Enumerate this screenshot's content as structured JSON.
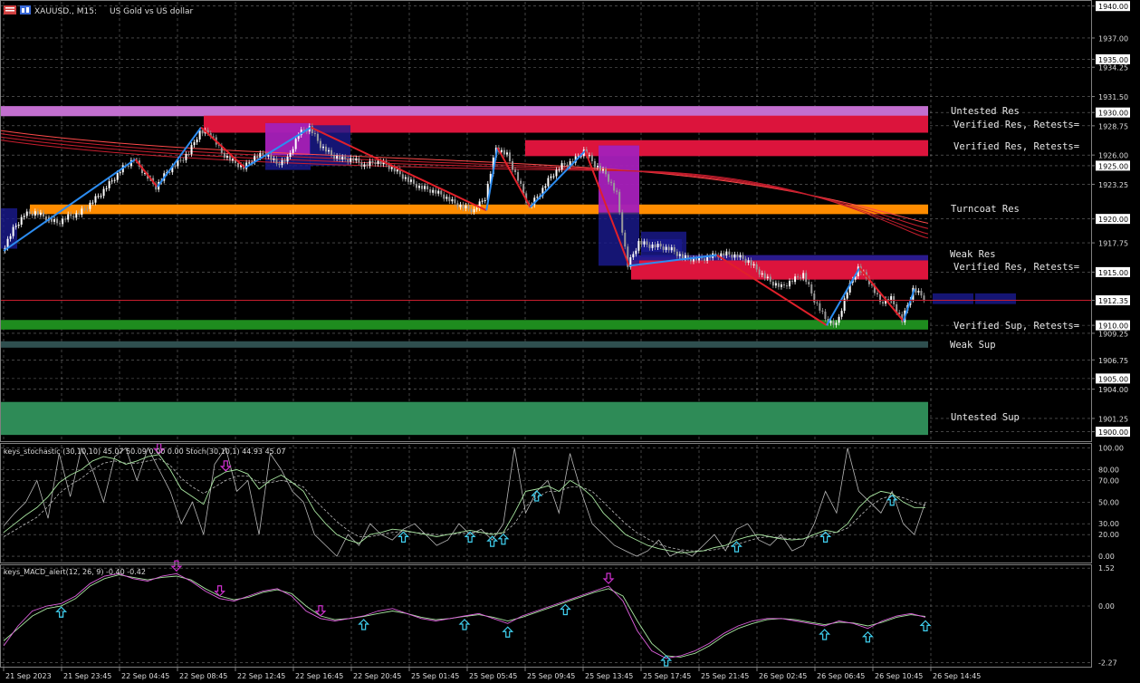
{
  "header": {
    "symbol": "XAUUSD., M15:",
    "description": "US Gold vs US dollar"
  },
  "colors": {
    "background": "#000000",
    "frame": "#7f7f7f",
    "candle_bull": "#ffffff",
    "candle_bear": "#9a9a9a",
    "zigzag_up": "#2c8cf0",
    "zigzag_down": "#e0202a",
    "ma": "#c81e2e",
    "untested_res": "#c26fcf",
    "verified_res": "#dc143c",
    "turncoat_res": "#ff8c00",
    "weak_res": "#2a1a8c",
    "verified_sup": "#1e8c1e",
    "weak_sup": "#2f4f4f",
    "untested_sup": "#2e8b57",
    "stoch_main": "#a8e6a0",
    "stoch_signal": "#b8b8b8",
    "macd_line": "#e060e0",
    "macd_signal": "#a8e6a0",
    "arrow_up": "#40d0f0",
    "arrow_down": "#d030d0",
    "price_box": "#ffffff"
  },
  "main_axis": {
    "ymin": 1899.2,
    "ymax": 1940.4,
    "labels": [
      "1940.00",
      "1937.00",
      "1935.00",
      "1934.25",
      "1931.50",
      "1930.00",
      "1928.75",
      "1926.00",
      "1925.00",
      "1923.25",
      "1920.00",
      "1917.75",
      "1915.00",
      "1912.35",
      "1910.00",
      "1909.25",
      "1906.75",
      "1905.00",
      "1904.00",
      "1901.25",
      "1900.00"
    ],
    "boxed": [
      "1940.00",
      "1935.00",
      "1930.00",
      "1925.00",
      "1920.00",
      "1915.00",
      "1912.35",
      "1910.00",
      "1905.00",
      "1900.00"
    ],
    "current_price": 1912.35
  },
  "zones": [
    {
      "label": "Untested Res",
      "color_key": "untested_res",
      "from": 1929.65,
      "to": 1930.6
    },
    {
      "label": "Verified Res, Retests=",
      "color_key": "verified_res",
      "from": 1928.1,
      "to": 1929.7
    },
    {
      "label": "Verified Res, Retests=",
      "color_key": "verified_res",
      "from": 1925.9,
      "to": 1927.4
    },
    {
      "label": "Turncoat Res",
      "color_key": "turncoat_res",
      "from": 1920.45,
      "to": 1921.35
    },
    {
      "label": "Weak Res",
      "color_key": "weak_res",
      "from": 1916.1,
      "to": 1916.6
    },
    {
      "label": "Verified Res, Retests=",
      "color_key": "verified_res",
      "from": 1914.3,
      "to": 1916.1
    },
    {
      "label": "Verified Sup, Retests=",
      "color_key": "verified_sup",
      "from": 1909.6,
      "to": 1910.5
    },
    {
      "label": "Weak Sup",
      "color_key": "weak_sup",
      "from": 1907.9,
      "to": 1908.5
    },
    {
      "label": "Untested Sup",
      "color_key": "untested_sup",
      "from": 1899.7,
      "to": 1902.8
    }
  ],
  "price_path": [
    1917.0,
    1919.0,
    1920.4,
    1920.6,
    1920.1,
    1919.6,
    1920.2,
    1920.5,
    1921.4,
    1922.4,
    1923.6,
    1924.8,
    1925.6,
    1924.2,
    1923.0,
    1924.4,
    1925.3,
    1926.2,
    1928.2,
    1928.0,
    1926.2,
    1925.4,
    1924.8,
    1925.8,
    1926.1,
    1925.2,
    1925.6,
    1928.0,
    1928.6,
    1926.9,
    1926.0,
    1925.6,
    1925.6,
    1925.0,
    1925.4,
    1925.1,
    1924.4,
    1923.6,
    1923.0,
    1922.7,
    1922.3,
    1921.6,
    1921.1,
    1920.8,
    1922.0,
    1926.7,
    1926.0,
    1923.7,
    1921.1,
    1922.4,
    1924.0,
    1925.0,
    1925.4,
    1926.4,
    1925.1,
    1924.2,
    1922.3,
    1915.6,
    1917.8,
    1917.5,
    1917.4,
    1917.1,
    1916.4,
    1916.2,
    1916.3,
    1916.6,
    1916.7,
    1916.5,
    1916.0,
    1915.0,
    1914.1,
    1913.6,
    1914.2,
    1914.8,
    1912.4,
    1910.6,
    1910.0,
    1913.2,
    1915.4,
    1914.1,
    1912.2,
    1912.5,
    1910.4,
    1913.4,
    1912.6
  ],
  "zigzag": [
    [
      0,
      1917.0
    ],
    [
      12,
      1925.6
    ],
    [
      14,
      1923.0
    ],
    [
      18,
      1928.6
    ],
    [
      22,
      1924.8
    ],
    [
      28,
      1928.6
    ],
    [
      44,
      1920.8
    ],
    [
      45,
      1926.7
    ],
    [
      48,
      1921.1
    ],
    [
      53,
      1926.4
    ],
    [
      57,
      1915.6
    ],
    [
      65,
      1916.6
    ],
    [
      75,
      1910.0
    ],
    [
      78,
      1915.4
    ],
    [
      82,
      1910.4
    ],
    [
      83,
      1913.4
    ]
  ],
  "stochastic": {
    "title": "keys_stochastic (30,10,10) 45.07 50.09 0.00 0.00 Stoch(30,10,1) 44.93 45.07",
    "ymin": -5,
    "ymax": 103,
    "labels": [
      "100.00",
      "80.00",
      "70.00",
      "50.00",
      "30.00",
      "20.00",
      "0.00"
    ],
    "main": [
      22,
      30,
      38,
      45,
      55,
      68,
      75,
      80,
      88,
      92,
      90,
      85,
      88,
      92,
      94,
      80,
      62,
      55,
      48,
      72,
      78,
      80,
      76,
      62,
      70,
      75,
      68,
      60,
      42,
      30,
      20,
      15,
      12,
      20,
      22,
      25,
      24,
      22,
      20,
      18,
      20,
      22,
      24,
      22,
      20,
      22,
      40,
      60,
      62,
      65,
      60,
      70,
      64,
      55,
      40,
      30,
      20,
      15,
      10,
      7,
      5,
      3,
      4,
      5,
      8,
      10,
      15,
      18,
      20,
      18,
      16,
      15,
      16,
      20,
      24,
      22,
      30,
      45,
      55,
      60,
      58,
      50,
      45,
      45
    ],
    "signal": [
      18,
      24,
      30,
      36,
      46,
      58,
      66,
      72,
      80,
      86,
      88,
      86,
      86,
      88,
      90,
      84,
      72,
      64,
      58,
      64,
      70,
      74,
      74,
      68,
      68,
      70,
      68,
      64,
      52,
      42,
      32,
      24,
      18,
      18,
      20,
      22,
      23,
      22,
      21,
      20,
      20,
      21,
      22,
      22,
      21,
      21,
      30,
      46,
      54,
      60,
      60,
      64,
      64,
      60,
      50,
      40,
      30,
      22,
      16,
      11,
      8,
      6,
      5,
      5,
      6,
      8,
      11,
      14,
      17,
      18,
      17,
      16,
      16,
      18,
      21,
      22,
      26,
      36,
      46,
      53,
      56,
      54,
      50,
      47
    ],
    "spiky": [
      28,
      40,
      50,
      70,
      35,
      95,
      55,
      100,
      80,
      50,
      92,
      100,
      70,
      100,
      80,
      60,
      30,
      50,
      20,
      85,
      100,
      60,
      70,
      20,
      95,
      80,
      60,
      50,
      20,
      10,
      0,
      20,
      10,
      30,
      20,
      15,
      25,
      30,
      20,
      10,
      15,
      30,
      20,
      25,
      15,
      30,
      100,
      40,
      60,
      70,
      40,
      95,
      60,
      30,
      20,
      10,
      5,
      0,
      5,
      15,
      0,
      5,
      0,
      10,
      20,
      5,
      25,
      30,
      15,
      10,
      20,
      5,
      10,
      30,
      60,
      40,
      100,
      60,
      50,
      40,
      60,
      30,
      20,
      50
    ],
    "arrows_down": [
      14,
      20
    ],
    "arrows_up": [
      36,
      42,
      44,
      45,
      48,
      66,
      74,
      80
    ]
  },
  "macd": {
    "title": "keys_MACD_alert(12, 26, 9) -0.40 -0.42",
    "ymin": -2.4,
    "ymax": 1.6,
    "labels": [
      "1.52",
      "0.00",
      "-2.27"
    ],
    "line": [
      -1.6,
      -0.8,
      -0.2,
      0.0,
      0.1,
      0.4,
      0.9,
      1.2,
      1.3,
      1.1,
      1.0,
      1.2,
      1.3,
      1.0,
      0.6,
      0.3,
      0.2,
      0.4,
      0.6,
      0.7,
      0.4,
      -0.2,
      -0.5,
      -0.6,
      -0.5,
      -0.4,
      -0.2,
      -0.1,
      -0.3,
      -0.5,
      -0.6,
      -0.5,
      -0.4,
      -0.3,
      -0.5,
      -0.7,
      -0.4,
      -0.2,
      0.0,
      0.2,
      0.4,
      0.6,
      0.8,
      0.2,
      -1.0,
      -1.8,
      -2.1,
      -2.0,
      -1.8,
      -1.5,
      -1.1,
      -0.8,
      -0.6,
      -0.5,
      -0.5,
      -0.6,
      -0.7,
      -0.8,
      -0.6,
      -0.7,
      -0.9,
      -0.6,
      -0.4,
      -0.3,
      -0.45
    ],
    "signal": [
      -1.4,
      -0.9,
      -0.4,
      -0.1,
      0.0,
      0.3,
      0.8,
      1.1,
      1.25,
      1.15,
      1.05,
      1.15,
      1.2,
      1.05,
      0.7,
      0.4,
      0.25,
      0.35,
      0.55,
      0.65,
      0.5,
      0.0,
      -0.4,
      -0.55,
      -0.5,
      -0.42,
      -0.3,
      -0.2,
      -0.3,
      -0.45,
      -0.55,
      -0.5,
      -0.42,
      -0.35,
      -0.45,
      -0.6,
      -0.45,
      -0.25,
      -0.05,
      0.15,
      0.35,
      0.55,
      0.7,
      0.4,
      -0.6,
      -1.5,
      -2.0,
      -2.05,
      -1.9,
      -1.6,
      -1.2,
      -0.9,
      -0.7,
      -0.55,
      -0.5,
      -0.55,
      -0.65,
      -0.75,
      -0.65,
      -0.68,
      -0.8,
      -0.65,
      -0.45,
      -0.35,
      -0.42
    ],
    "arrows_down": [
      12,
      15,
      22,
      42
    ],
    "arrows_up": [
      4,
      25,
      32,
      35,
      39,
      46,
      57,
      60,
      64
    ]
  },
  "time_axis": {
    "labels": [
      "21 Sep 2023",
      "21 Sep 23:45",
      "22 Sep 04:45",
      "22 Sep 08:45",
      "22 Sep 12:45",
      "22 Sep 16:45",
      "22 Sep 20:45",
      "25 Sep 01:45",
      "25 Sep 05:45",
      "25 Sep 09:45",
      "25 Sep 13:45",
      "25 Sep 17:45",
      "25 Sep 21:45",
      "26 Sep 02:45",
      "26 Sep 06:45",
      "26 Sep 10:45",
      "26 Sep 14:45"
    ]
  }
}
